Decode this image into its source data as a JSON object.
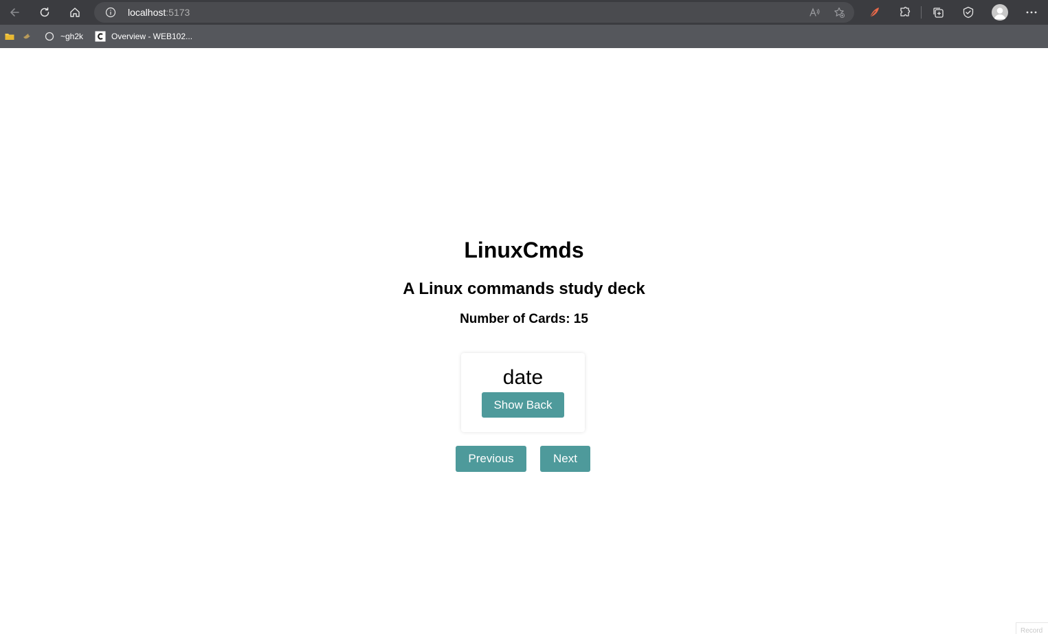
{
  "browser": {
    "url_host": "localhost",
    "url_port": ":5173",
    "bookmarks": [
      {
        "label": "~gh2k"
      },
      {
        "label": "Overview - WEB102..."
      }
    ]
  },
  "app": {
    "title": "LinuxCmds",
    "subtitle": "A Linux commands study deck",
    "card_count_label": "Number of Cards: 15",
    "card": {
      "front": "date",
      "show_back_label": "Show Back"
    },
    "nav": {
      "previous_label": "Previous",
      "next_label": "Next"
    }
  },
  "overlay": {
    "corner_text": "Record"
  },
  "colors": {
    "chrome_bg": "#3b3c40",
    "bookmarks_bg": "#55575c",
    "button_bg": "#4e9a9b",
    "accent_feather": "#e8694a"
  }
}
